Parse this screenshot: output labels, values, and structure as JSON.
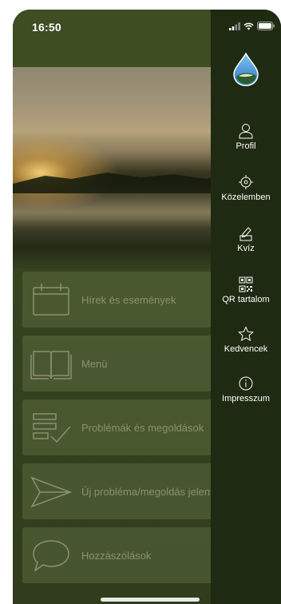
{
  "status_bar": {
    "time": "16:50"
  },
  "drawer": {
    "items": [
      {
        "label": "Profil",
        "icon": "user-icon"
      },
      {
        "label": "Közelemben",
        "icon": "locate-icon"
      },
      {
        "label": "Kvíz",
        "icon": "edit-icon"
      },
      {
        "label": "QR tartalom",
        "icon": "qr-code-icon"
      },
      {
        "label": "Kedvencek",
        "icon": "star-icon"
      },
      {
        "label": "Impresszum",
        "icon": "info-icon"
      }
    ]
  },
  "main": {
    "tiles": [
      {
        "label": "Hírek és események",
        "icon": "calendar-icon"
      },
      {
        "label": "Menü",
        "icon": "book-icon"
      },
      {
        "label": "Problémák és megoldások",
        "icon": "checklist-icon"
      },
      {
        "label": "Új probléma/megoldás jelentése",
        "icon": "send-icon"
      },
      {
        "label": "Hozzászólások",
        "icon": "comment-icon"
      }
    ]
  },
  "colors": {
    "drawer_bg": "#1f2a12",
    "screen_overlay": "#3a4720",
    "tile_bg": "#5a693c",
    "tile_text": "#8a9172",
    "text_light": "#ffffff"
  }
}
